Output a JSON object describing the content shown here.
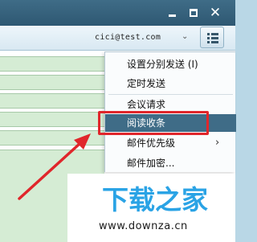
{
  "window": {
    "minimize_icon": "minimize-icon",
    "maximize_icon": "maximize-icon",
    "close_glyph": "✕"
  },
  "header": {
    "account": "cici@test.com",
    "account_chevron": "⌄",
    "menu_icon": "list-menu-icon"
  },
  "menu": {
    "items": [
      {
        "label": "设置分别发送 (I)",
        "submenu": false
      },
      {
        "label": "定时发送",
        "submenu": false
      },
      {
        "label": "会议请求",
        "submenu": false
      },
      {
        "label": "阅读收条",
        "submenu": false,
        "selected": true
      },
      {
        "label": "邮件优先级",
        "submenu": true,
        "arrow": "›"
      },
      {
        "label": "邮件加密...",
        "submenu": false
      }
    ]
  },
  "annotation": {
    "color": "#e0262b",
    "target": "阅读收条"
  },
  "watermark": {
    "logo_text": "下载之家",
    "url": "www.downza.cn"
  }
}
